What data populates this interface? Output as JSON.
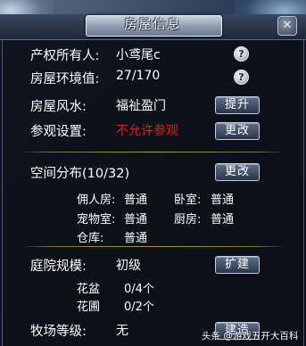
{
  "window": {
    "title": "房屋信息",
    "close_glyph": "✕"
  },
  "owner": {
    "label": "产权所有人:",
    "value": "小鸢尾c"
  },
  "environment": {
    "label": "房屋环境值:",
    "value": "27/170"
  },
  "fengshui": {
    "label": "房屋风水:",
    "value": "福祉盈门",
    "button_label": "提升"
  },
  "visit": {
    "label": "参观设置:",
    "value": "不允许参观",
    "value_color": "#d61f1f",
    "button_label": "更改"
  },
  "space": {
    "label": "空间分布(10/32)",
    "button_label": "更改",
    "rooms": [
      {
        "name": "佣人房:",
        "level": "普通"
      },
      {
        "name": "卧室:",
        "level": "普通"
      },
      {
        "name": "宠物室:",
        "level": "普通"
      },
      {
        "name": "厨房:",
        "level": "普通"
      },
      {
        "name": "仓库:",
        "level": "普通"
      }
    ]
  },
  "courtyard": {
    "label": "庭院规模:",
    "value": "初级",
    "button_label": "扩建",
    "items": [
      {
        "name": "花盆",
        "value": "0/4个"
      },
      {
        "name": "花圃",
        "value": "0/2个"
      }
    ]
  },
  "ranch": {
    "label": "牧场等级:",
    "value": "无",
    "button_label": "建造"
  },
  "help_glyph": "?",
  "watermark": "头条 @游戏五开大百科"
}
